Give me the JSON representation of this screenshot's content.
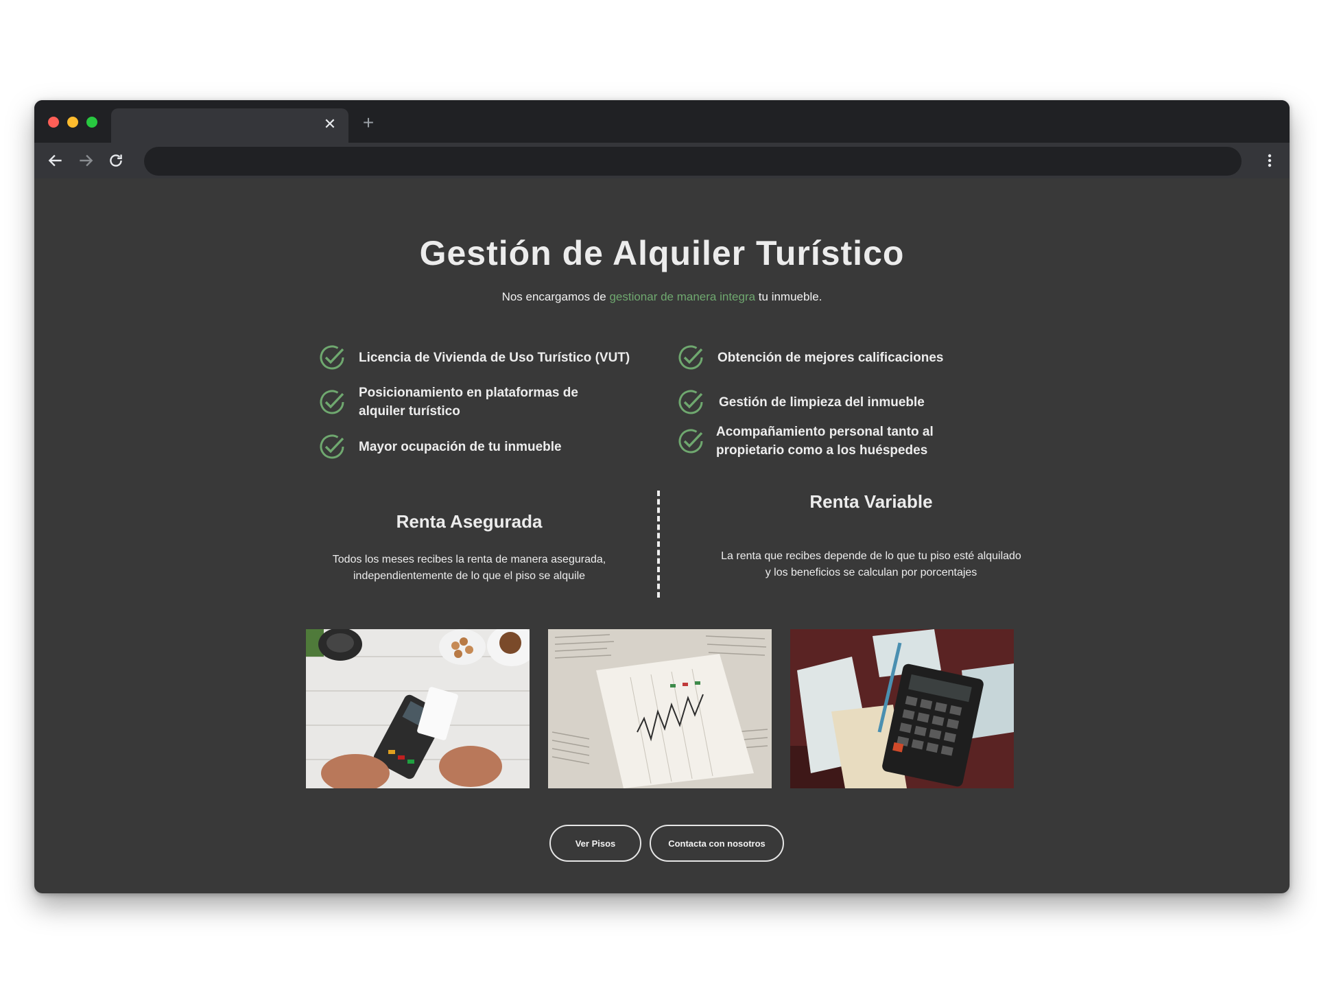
{
  "browser": {
    "tab_close_glyph": "✕",
    "new_tab_glyph": "+",
    "icons": [
      "back-arrow-icon",
      "forward-arrow-icon",
      "reload-icon",
      "kebab-menu-icon"
    ]
  },
  "hero": {
    "title": "Gestión de Alquiler Turístico",
    "subtitle_before": "Nos encargamos de ",
    "subtitle_accent": "gestionar de manera integra",
    "subtitle_after": " tu inmueble.",
    "accent_color": "#6fa86f"
  },
  "features": {
    "left": [
      "Licencia de Vivienda de Uso Turístico (VUT)",
      "Posicionamiento en plataformas de alquiler turístico",
      "Mayor ocupación de tu inmueble"
    ],
    "right": [
      "Obtención de mejores calificaciones",
      "Gestión de limpieza del inmueble",
      "Acompañamiento personal tanto al propietario como a los huéspedes"
    ],
    "icon": "check-circle-icon"
  },
  "plans": {
    "fixed": {
      "title": "Renta Asegurada",
      "description": "Todos los meses recibes la renta de manera asegurada, independientemente de lo que el piso se alquile"
    },
    "variable": {
      "title": "Renta Variable",
      "description": "La renta que recibes depende de lo que tu piso esté alquilado y los beneficios se calculan por porcentajes"
    }
  },
  "photos": [
    "card-payment-photo",
    "stock-chart-photo",
    "calculator-photo"
  ],
  "buttons": {
    "see_flats": "Ver Pisos",
    "contact": "Contacta con nosotros"
  }
}
